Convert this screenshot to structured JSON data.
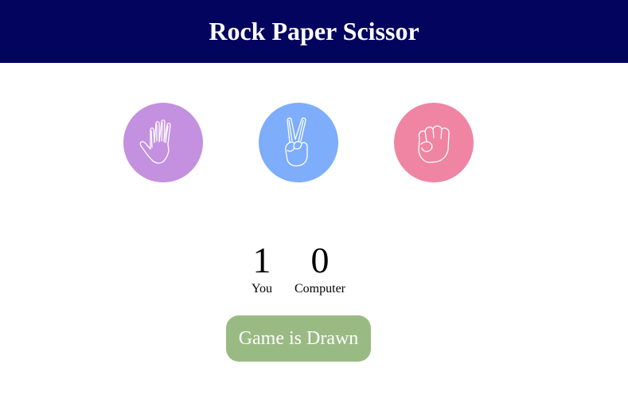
{
  "header": {
    "title": "Rock Paper Scissor",
    "background": "#03045e"
  },
  "choices": [
    {
      "name": "paper",
      "icon": "paper-hand-icon",
      "color": "#c490e0"
    },
    {
      "name": "scissor",
      "icon": "scissor-hand-icon",
      "color": "#7dadfb"
    },
    {
      "name": "rock",
      "icon": "rock-fist-icon",
      "color": "#ef85a3"
    }
  ],
  "score": {
    "you": "1",
    "you_label": "You",
    "computer": "0",
    "computer_label": "Computer"
  },
  "result": {
    "message": "Game is Drawn",
    "color": "#9aba84"
  }
}
